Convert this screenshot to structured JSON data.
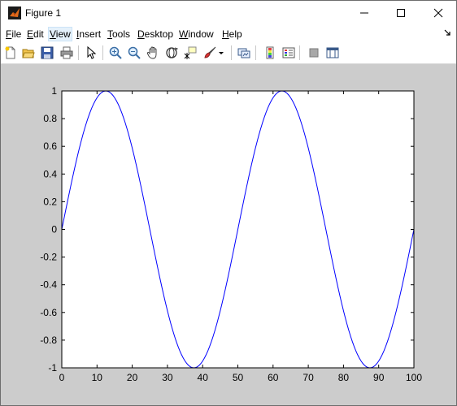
{
  "window": {
    "title": "Figure 1"
  },
  "menubar": {
    "items": [
      {
        "key": "F",
        "rest": "ile"
      },
      {
        "key": "E",
        "rest": "dit"
      },
      {
        "key": "V",
        "rest": "iew"
      },
      {
        "key": "I",
        "rest": "nsert"
      },
      {
        "key": "T",
        "rest": "ools"
      },
      {
        "key": "D",
        "rest": "esktop"
      },
      {
        "key": "W",
        "rest": "indow"
      },
      {
        "key": "H",
        "rest": "elp"
      }
    ],
    "active_item": "View"
  },
  "toolbar": {
    "icons": [
      "new-figure-icon",
      "open-file-icon",
      "save-icon",
      "print-icon",
      "select-arrow-icon",
      "zoom-in-icon",
      "zoom-out-icon",
      "pan-hand-icon",
      "rotate-3d-icon",
      "data-cursor-icon",
      "brush-icon",
      "link-plot-icon",
      "colorbar-icon",
      "legend-icon",
      "hide-plot-tools-icon",
      "show-plot-tools-icon"
    ]
  },
  "colors": {
    "line": "#0000ff",
    "figure_background": "#cccccc",
    "axes_background": "#ffffff"
  },
  "chart_data": {
    "type": "line",
    "title": "",
    "xlabel": "",
    "ylabel": "",
    "xlim": [
      0,
      100
    ],
    "ylim": [
      -1,
      1
    ],
    "xticks": [
      0,
      10,
      20,
      30,
      40,
      50,
      60,
      70,
      80,
      90,
      100
    ],
    "yticks": [
      1,
      0.8,
      0.6,
      0.4,
      0.2,
      0,
      -0.2,
      -0.4,
      -0.6,
      -0.8,
      -1
    ],
    "ytick_labels": [
      "1",
      "0.8",
      "0.6",
      "0.4",
      "0.2",
      "0",
      "-0.2",
      "-0.4",
      "-0.6",
      "-0.8",
      "-1"
    ],
    "xtick_labels": [
      "0",
      "10",
      "20",
      "30",
      "40",
      "50",
      "60",
      "70",
      "80",
      "90",
      "100"
    ],
    "grid": false,
    "series": [
      {
        "function": "sin(2*pi*x/50)",
        "x": [
          0,
          2,
          4,
          6,
          8,
          10,
          12,
          14,
          16,
          18,
          20,
          22,
          24,
          26,
          28,
          30,
          32,
          34,
          36,
          38,
          40,
          42,
          44,
          46,
          48,
          50,
          52,
          54,
          56,
          58,
          60,
          62,
          64,
          66,
          68,
          70,
          72,
          74,
          76,
          78,
          80,
          82,
          84,
          86,
          88,
          90,
          92,
          94,
          96,
          98,
          100
        ],
        "y": [
          0,
          0.249,
          0.482,
          0.685,
          0.844,
          0.951,
          0.998,
          0.982,
          0.905,
          0.771,
          0.588,
          0.368,
          0.125,
          -0.125,
          -0.368,
          -0.588,
          -0.771,
          -0.905,
          -0.982,
          -0.998,
          -0.951,
          -0.844,
          -0.685,
          -0.482,
          -0.249,
          0,
          0.249,
          0.482,
          0.685,
          0.844,
          0.951,
          0.998,
          0.982,
          0.905,
          0.771,
          0.588,
          0.368,
          0.125,
          -0.125,
          -0.368,
          -0.588,
          -0.771,
          -0.905,
          -0.982,
          -0.998,
          -0.951,
          -0.844,
          -0.685,
          -0.482,
          -0.249,
          0
        ]
      }
    ]
  }
}
